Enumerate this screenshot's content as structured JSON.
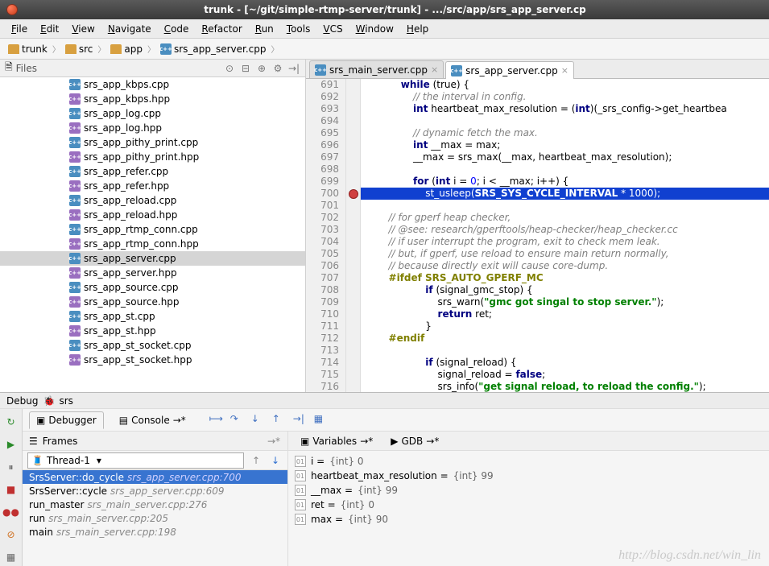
{
  "title": "trunk - [~/git/simple-rtmp-server/trunk] - .../src/app/srs_app_server.cp",
  "menu": [
    "File",
    "Edit",
    "View",
    "Navigate",
    "Code",
    "Refactor",
    "Run",
    "Tools",
    "VCS",
    "Window",
    "Help"
  ],
  "breadcrumbs": [
    {
      "icon": "folder",
      "label": "trunk"
    },
    {
      "icon": "folder",
      "label": "src"
    },
    {
      "icon": "folder",
      "label": "app"
    },
    {
      "icon": "cpp",
      "label": "srs_app_server.cpp"
    }
  ],
  "file_panel": {
    "title": "Files"
  },
  "files": [
    {
      "name": "srs_app_kbps.cpp",
      "type": "cpp"
    },
    {
      "name": "srs_app_kbps.hpp",
      "type": "hpp"
    },
    {
      "name": "srs_app_log.cpp",
      "type": "cpp"
    },
    {
      "name": "srs_app_log.hpp",
      "type": "hpp"
    },
    {
      "name": "srs_app_pithy_print.cpp",
      "type": "cpp"
    },
    {
      "name": "srs_app_pithy_print.hpp",
      "type": "hpp"
    },
    {
      "name": "srs_app_refer.cpp",
      "type": "cpp"
    },
    {
      "name": "srs_app_refer.hpp",
      "type": "hpp"
    },
    {
      "name": "srs_app_reload.cpp",
      "type": "cpp"
    },
    {
      "name": "srs_app_reload.hpp",
      "type": "hpp"
    },
    {
      "name": "srs_app_rtmp_conn.cpp",
      "type": "cpp"
    },
    {
      "name": "srs_app_rtmp_conn.hpp",
      "type": "hpp"
    },
    {
      "name": "srs_app_server.cpp",
      "type": "cpp",
      "selected": true
    },
    {
      "name": "srs_app_server.hpp",
      "type": "hpp"
    },
    {
      "name": "srs_app_source.cpp",
      "type": "cpp"
    },
    {
      "name": "srs_app_source.hpp",
      "type": "hpp"
    },
    {
      "name": "srs_app_st.cpp",
      "type": "cpp"
    },
    {
      "name": "srs_app_st.hpp",
      "type": "hpp"
    },
    {
      "name": "srs_app_st_socket.cpp",
      "type": "cpp"
    },
    {
      "name": "srs_app_st_socket.hpp",
      "type": "hpp"
    }
  ],
  "editor_tabs": [
    {
      "label": "srs_main_server.cpp",
      "active": false
    },
    {
      "label": "srs_app_server.cpp",
      "active": true
    }
  ],
  "line_start": 691,
  "current_line": 700,
  "code_lines": [
    {
      "n": 691,
      "indent": 12,
      "tokens": [
        {
          "t": "kw",
          "v": "while"
        },
        {
          "v": " (true) {"
        }
      ]
    },
    {
      "n": 692,
      "indent": 16,
      "tokens": [
        {
          "t": "cmt",
          "v": "// the interval in config."
        }
      ]
    },
    {
      "n": 693,
      "indent": 16,
      "tokens": [
        {
          "t": "kw",
          "v": "int"
        },
        {
          "v": " heartbeat_max_resolution = ("
        },
        {
          "t": "kw",
          "v": "int"
        },
        {
          "v": ")(_srs_config->get_heartbea"
        }
      ]
    },
    {
      "n": 694,
      "indent": 0,
      "tokens": []
    },
    {
      "n": 695,
      "indent": 16,
      "tokens": [
        {
          "t": "cmt",
          "v": "// dynamic fetch the max."
        }
      ]
    },
    {
      "n": 696,
      "indent": 16,
      "tokens": [
        {
          "t": "kw",
          "v": "int"
        },
        {
          "v": " __max = max;"
        }
      ]
    },
    {
      "n": 697,
      "indent": 16,
      "tokens": [
        {
          "v": "__max = srs_max(__max, heartbeat_max_resolution);"
        }
      ]
    },
    {
      "n": 698,
      "indent": 0,
      "tokens": []
    },
    {
      "n": 699,
      "indent": 16,
      "tokens": [
        {
          "t": "kw",
          "v": "for"
        },
        {
          "v": " ("
        },
        {
          "t": "kw",
          "v": "int"
        },
        {
          "v": " i = "
        },
        {
          "t": "num",
          "v": "0"
        },
        {
          "v": "; i < __max; i++) {"
        }
      ]
    },
    {
      "n": 700,
      "indent": 20,
      "current": true,
      "tokens": [
        {
          "v": "st_usleep("
        },
        {
          "t": "bold",
          "v": "SRS_SYS_CYCLE_INTERVAL"
        },
        {
          "v": " * "
        },
        {
          "v": "1000);"
        }
      ]
    },
    {
      "n": 701,
      "indent": 0,
      "tokens": []
    },
    {
      "n": 702,
      "indent": 8,
      "tokens": [
        {
          "t": "cmt",
          "v": "// for gperf heap checker,"
        }
      ]
    },
    {
      "n": 703,
      "indent": 8,
      "tokens": [
        {
          "t": "cmt",
          "v": "// @see: research/gperftools/heap-checker/heap_checker.cc"
        }
      ]
    },
    {
      "n": 704,
      "indent": 8,
      "tokens": [
        {
          "t": "cmt",
          "v": "// if user interrupt the program, exit to check mem leak."
        }
      ]
    },
    {
      "n": 705,
      "indent": 8,
      "tokens": [
        {
          "t": "cmt",
          "v": "// but, if gperf, use reload to ensure main return normally,"
        }
      ]
    },
    {
      "n": 706,
      "indent": 8,
      "tokens": [
        {
          "t": "cmt",
          "v": "// because directly exit will cause core-dump."
        }
      ]
    },
    {
      "n": 707,
      "indent": 8,
      "tokens": [
        {
          "t": "pp",
          "v": "#ifdef SRS_AUTO_GPERF_MC"
        }
      ]
    },
    {
      "n": 708,
      "indent": 20,
      "tokens": [
        {
          "t": "kw",
          "v": "if"
        },
        {
          "v": " (signal_gmc_stop) {"
        }
      ]
    },
    {
      "n": 709,
      "indent": 24,
      "tokens": [
        {
          "v": "srs_warn("
        },
        {
          "t": "str",
          "v": "\"gmc got singal to stop server.\""
        },
        {
          "v": ");"
        }
      ]
    },
    {
      "n": 710,
      "indent": 24,
      "tokens": [
        {
          "t": "kw",
          "v": "return"
        },
        {
          "v": " ret;"
        }
      ]
    },
    {
      "n": 711,
      "indent": 20,
      "tokens": [
        {
          "v": "}"
        }
      ]
    },
    {
      "n": 712,
      "indent": 8,
      "tokens": [
        {
          "t": "pp",
          "v": "#endif"
        }
      ]
    },
    {
      "n": 713,
      "indent": 0,
      "tokens": []
    },
    {
      "n": 714,
      "indent": 20,
      "tokens": [
        {
          "t": "kw",
          "v": "if"
        },
        {
          "v": " (signal_reload) {"
        }
      ]
    },
    {
      "n": 715,
      "indent": 24,
      "tokens": [
        {
          "v": "signal_reload = "
        },
        {
          "t": "kw",
          "v": "false"
        },
        {
          "v": ";"
        }
      ]
    },
    {
      "n": 716,
      "indent": 24,
      "tokens": [
        {
          "v": "srs_info("
        },
        {
          "t": "str",
          "v": "\"get signal reload, to reload the config.\""
        },
        {
          "v": ");"
        }
      ]
    }
  ],
  "debug": {
    "label": "Debug",
    "target": "srs",
    "tabs": {
      "debugger": "Debugger",
      "console": "Console"
    },
    "frames_title": "Frames",
    "thread": "Thread-1",
    "frames": [
      {
        "fn": "SrsServer::do_cycle",
        "loc": "srs_app_server.cpp:700",
        "selected": true
      },
      {
        "fn": "SrsServer::cycle",
        "loc": "srs_app_server.cpp:609"
      },
      {
        "fn": "run_master",
        "loc": "srs_main_server.cpp:276"
      },
      {
        "fn": "run",
        "loc": "srs_main_server.cpp:205"
      },
      {
        "fn": "main",
        "loc": "srs_main_server.cpp:198"
      }
    ],
    "vars_tabs": {
      "variables": "Variables",
      "gdb": "GDB"
    },
    "vars": [
      {
        "name": "i",
        "val": "{int} 0"
      },
      {
        "name": "heartbeat_max_resolution",
        "val": "{int} 99"
      },
      {
        "name": "__max",
        "val": "{int} 99"
      },
      {
        "name": "ret",
        "val": "{int} 0"
      },
      {
        "name": "max",
        "val": "{int} 90"
      }
    ]
  },
  "watermark": "http://blog.csdn.net/win_lin"
}
